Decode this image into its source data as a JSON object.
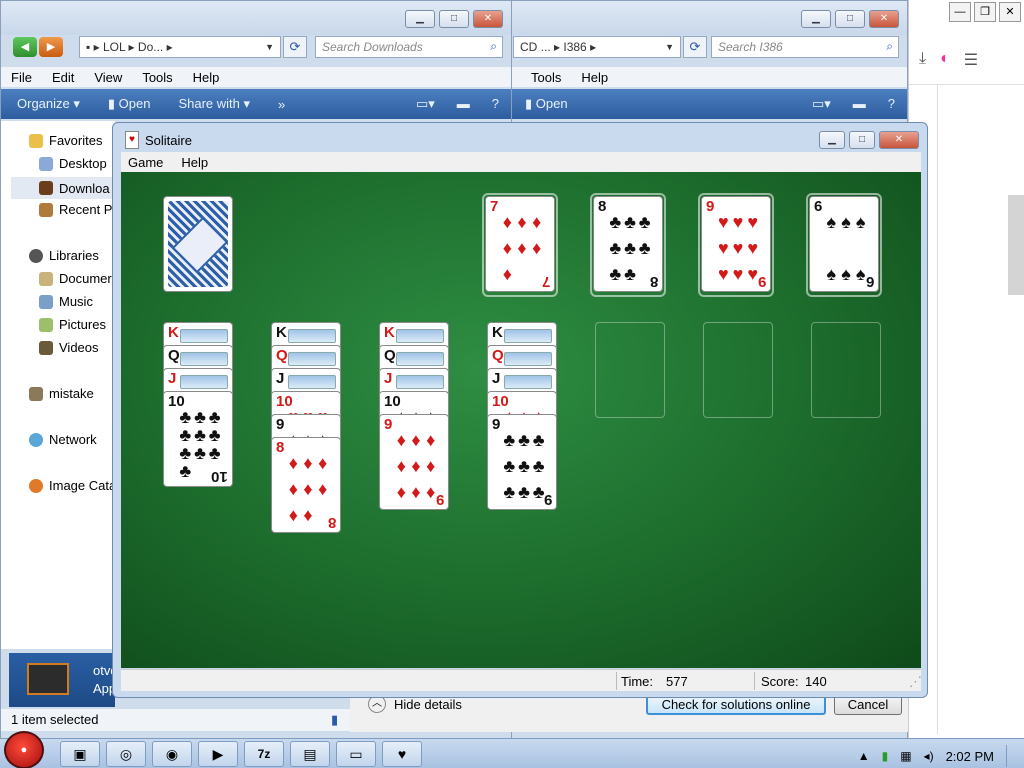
{
  "explorer_left": {
    "breadcrumb": [
      "LOL",
      "Do..."
    ],
    "search_placeholder": "Search Downloads",
    "menu": [
      "File",
      "Edit",
      "View",
      "Tools",
      "Help"
    ],
    "commands": [
      "Organize",
      "Open",
      "Share with",
      "»"
    ],
    "nav": {
      "favorites": "Favorites",
      "desktop": "Desktop",
      "downloads": "Downloa",
      "recent": "Recent Pl",
      "libraries": "Libraries",
      "documents": "Documer",
      "music": "Music",
      "pictures": "Pictures",
      "videos": "Videos",
      "mistake": "mistake",
      "network": "Network",
      "image_cata": "Image Cata"
    },
    "details": {
      "line1": "otvd",
      "line2": "Appl"
    },
    "status": "1 item selected"
  },
  "explorer_right": {
    "breadcrumb": [
      "CD ...",
      "I386"
    ],
    "search_placeholder": "Search I386",
    "menu": [
      "Tools",
      "Help"
    ],
    "commands": [
      "Open"
    ]
  },
  "dialog": {
    "hide_details": "Hide details",
    "check_online": "Check for solutions online",
    "cancel": "Cancel"
  },
  "solitaire": {
    "title": "Solitaire",
    "menu": [
      "Game",
      "Help"
    ],
    "time_label": "Time:",
    "time": "577",
    "score_label": "Score:",
    "score": "140",
    "foundations": [
      {
        "rank": "7",
        "suit": "♦",
        "color": "red"
      },
      {
        "rank": "8",
        "suit": "♣",
        "color": "black"
      },
      {
        "rank": "9",
        "suit": "♥",
        "color": "red"
      },
      {
        "rank": "6",
        "suit": "♠",
        "color": "black"
      }
    ],
    "tableau": [
      [
        {
          "rank": "K",
          "suit": "♥",
          "color": "red"
        },
        {
          "rank": "Q",
          "suit": "♠",
          "color": "black"
        },
        {
          "rank": "J",
          "suit": "♥",
          "color": "red"
        },
        {
          "rank": "10",
          "suit": "♣",
          "color": "black"
        }
      ],
      [
        {
          "rank": "K",
          "suit": "♠",
          "color": "black"
        },
        {
          "rank": "Q",
          "suit": "♦",
          "color": "red"
        },
        {
          "rank": "J",
          "suit": "♠",
          "color": "black"
        },
        {
          "rank": "10",
          "suit": "♥",
          "color": "red"
        },
        {
          "rank": "9",
          "suit": "♠",
          "color": "black"
        },
        {
          "rank": "8",
          "suit": "♦",
          "color": "red"
        }
      ],
      [
        {
          "rank": "K",
          "suit": "♦",
          "color": "red"
        },
        {
          "rank": "Q",
          "suit": "♣",
          "color": "black"
        },
        {
          "rank": "J",
          "suit": "♦",
          "color": "red"
        },
        {
          "rank": "10",
          "suit": "♠",
          "color": "black"
        },
        {
          "rank": "9",
          "suit": "♦",
          "color": "red"
        }
      ],
      [
        {
          "rank": "K",
          "suit": "♣",
          "color": "black"
        },
        {
          "rank": "Q",
          "suit": "♦",
          "color": "red"
        },
        {
          "rank": "J",
          "suit": "♣",
          "color": "black"
        },
        {
          "rank": "10",
          "suit": "♦",
          "color": "red"
        },
        {
          "rank": "9",
          "suit": "♣",
          "color": "black"
        }
      ]
    ]
  },
  "taskbar": {
    "clock": "2:02 PM",
    "apps": [
      "explorer-icon",
      "chrome-icon",
      "firefox-icon",
      "media-player-icon",
      "7zip-icon",
      "window-icon",
      "card-icon",
      "solitaire-icon"
    ],
    "seven_zip": "7z"
  }
}
